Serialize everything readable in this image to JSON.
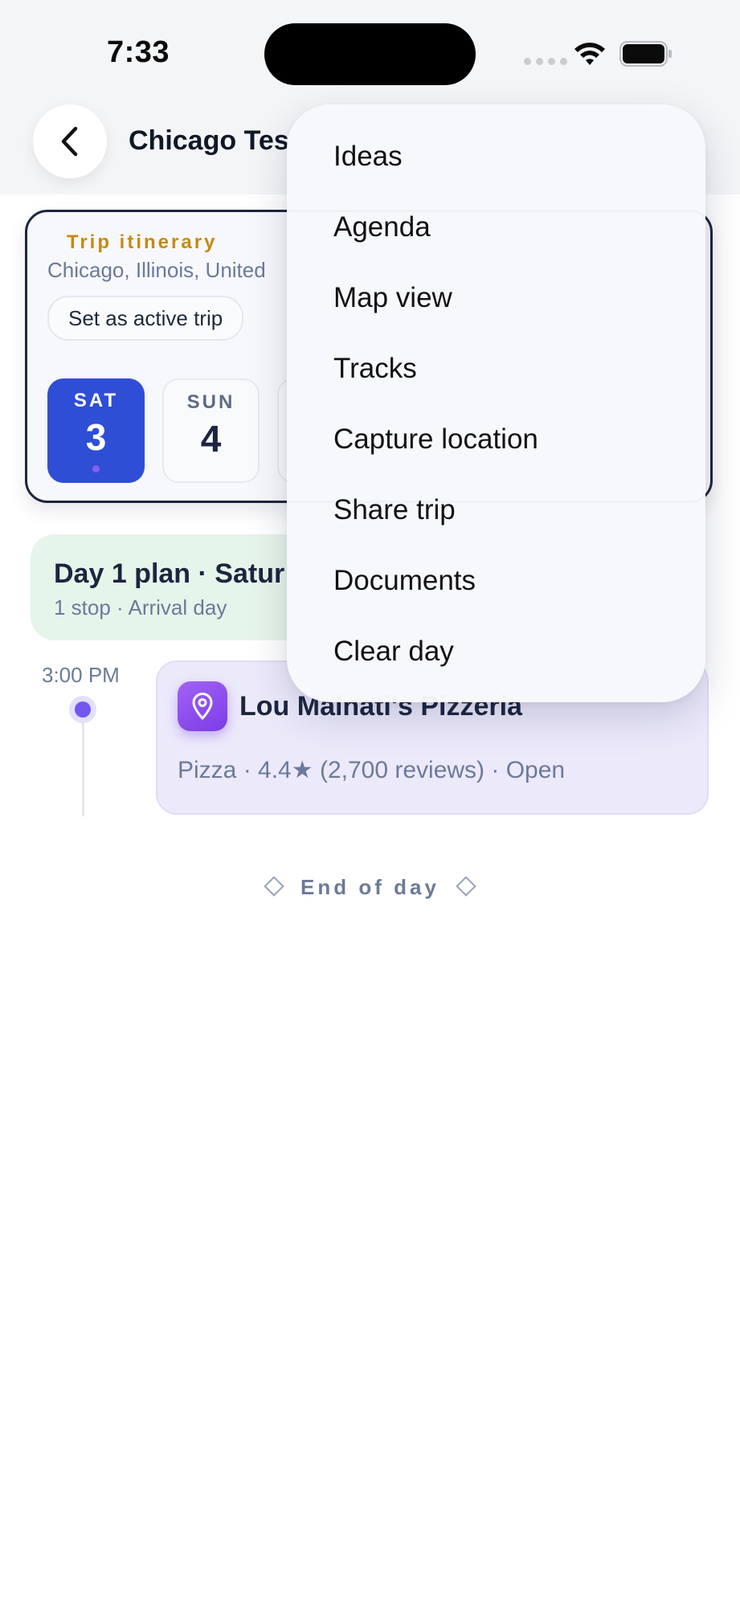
{
  "status_bar": {
    "time": "7:33"
  },
  "header": {
    "title": "Chicago Tes"
  },
  "itinerary": {
    "eyebrow": "Trip itinerary",
    "location": "Chicago, Illinois, United",
    "active_trip_button": "Set as active trip",
    "days": [
      {
        "dow": "SAT",
        "dom": "3",
        "selected": true
      },
      {
        "dow": "SUN",
        "dom": "4",
        "selected": false
      }
    ]
  },
  "day_plan": {
    "title": "Day 1 plan · Satur",
    "subtitle": "1 stop · Arrival day"
  },
  "timeline": {
    "time": "3:00 PM",
    "stop": {
      "name": "Lou Malnati's Pizzeria",
      "meta": "Pizza · 4.4★ (2,700 reviews) · Open",
      "icon": "location-pin-icon"
    },
    "end_label": "End of day"
  },
  "menu": {
    "items": [
      "Ideas",
      "Agenda",
      "Map view",
      "Tracks",
      "Capture location",
      "Share trip",
      "Documents",
      "Clear day"
    ]
  },
  "colors": {
    "accent_blue": "#2f4ed6",
    "accent_purple": "#7357ee",
    "eyebrow_gold": "#c58a12",
    "plan_green": "#e6f5ea"
  }
}
